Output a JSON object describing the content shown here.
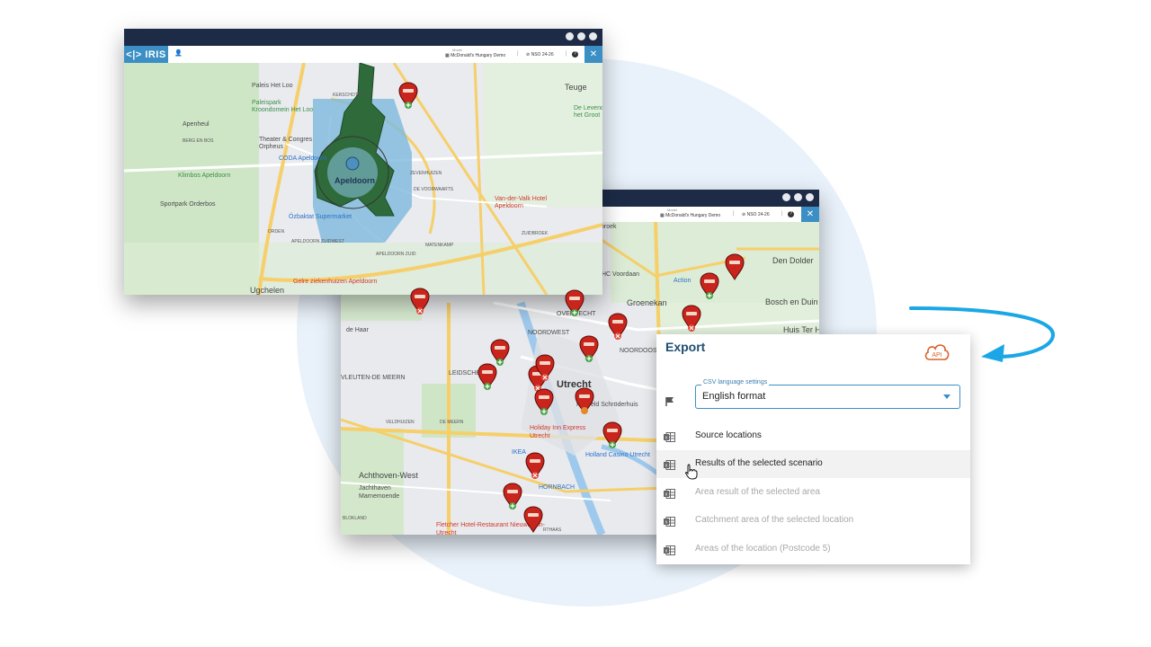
{
  "window_top": {
    "logo": "IRIS",
    "model_label": "Model",
    "model_name": "McDonald's Hungary Demo",
    "scenario": "NSO 24-26",
    "help": "?",
    "map_labels": {
      "city": "Apeldoorn",
      "teuge": "Teuge",
      "paleis": "Paleis Het Loo",
      "paleispark": "Paleispark Kroondomein Het Loo",
      "theater": "Theater & Congres Orpheus",
      "coda": "CODA Apeldoorn",
      "klimbos": "Klimbos Apeldoorn",
      "sportpark": "Sportpark Orderbos",
      "ozbaktat": "Özbaktat Supermarket",
      "vandervalk": "Van-der-Valk Hotel Apeldoorn",
      "ugchelen": "Ugchelen",
      "gelre": "Gelre ziekenhuizen Apeldoorn",
      "delevende": "De Levende het Groot",
      "apenheul": "Apenheul",
      "kerschoten": "KERSCHOTEN",
      "zevenhuizen": "ZEVENHUIZEN",
      "voorwaarts": "DE VOORWAARTS",
      "matenkamp": "MATENKAMP",
      "zuidbroek": "ZUIDBROEK",
      "apeldoorn_zuid": "APELDOORN ZUID",
      "apeldoorn_zuidwest": "APELDOORN ZUIDWEST",
      "orden": "ORDEN",
      "berg_en_bos": "BERG EN BOS"
    }
  },
  "window_bottom": {
    "model_label": "Model",
    "model_name": "McDonald's Hungary Demo",
    "scenario": "NSO 24-26",
    "help": "?",
    "map_labels": {
      "city": "Utrecht",
      "broek": "broek",
      "den_dolder": "Den Dolder",
      "bosch_en_duin": "Bosch en Duin",
      "groenekan": "Groenekan",
      "huis_ter_heide": "Huis Ter He",
      "action": "Action",
      "voordaan": "HC Voordaan",
      "overvecht": "OVERVECHT",
      "noordwest": "NOORDWEST",
      "noordoost": "NOORDOOST",
      "vleuten": "VLEUTEN-DE MEERN",
      "leidsche": "LEIDSCHE",
      "veldhuizen": "VELDHUIZEN",
      "de_meern": "DE MEERN",
      "achthoven": "Achthoven-West",
      "jachthaven": "Jachthaven Marnemoende",
      "holiday": "Holiday Inn Express Utrecht",
      "ikea": "IKEA",
      "holland_casino": "Holland Casino Utrecht",
      "hornbach": "HORNBACH",
      "schroderhuis": "Rietveld Schröderhuis",
      "fletcher": "Fletcher Hotel-Restaurant Nieuwegein-Utrecht",
      "rhaas": "RTHAAS",
      "blokland": "BLOKLAND",
      "de_haar": "de Haar"
    }
  },
  "export": {
    "title": "Export",
    "api_label": "API",
    "csv_legend": "CSV language settings",
    "csv_value": "English format",
    "items": [
      {
        "label": "Source locations",
        "enabled": true
      },
      {
        "label": "Results of the selected scenario",
        "enabled": true
      },
      {
        "label": "Area result of the selected area",
        "enabled": false
      },
      {
        "label": "Catchment area of the selected location",
        "enabled": false
      },
      {
        "label": "Areas of the location (Postcode 5)",
        "enabled": false
      }
    ]
  },
  "colors": {
    "titlebar": "#1d2b47",
    "accent": "#3b8fc5",
    "pin_red": "#c9251c",
    "catchment_green": "#2f6b3a",
    "catchment_blue": "#7db9dc",
    "arrow": "#1ba7e5"
  }
}
